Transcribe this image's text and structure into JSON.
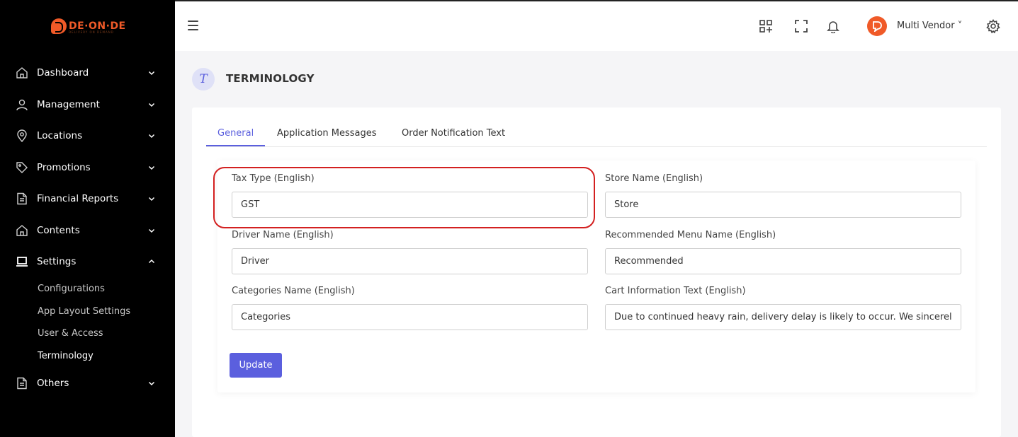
{
  "brand": {
    "logo_text": "DE·ON·DE",
    "logo_subtext": "DELIVERY ON DEMAND",
    "accent_color": "#f05a28"
  },
  "sidebar": {
    "items": [
      {
        "label": "Dashboard",
        "icon": "home-icon"
      },
      {
        "label": "Management",
        "icon": "user-icon"
      },
      {
        "label": "Locations",
        "icon": "map-pin-icon"
      },
      {
        "label": "Promotions",
        "icon": "tag-icon"
      },
      {
        "label": "Financial Reports",
        "icon": "file-icon"
      },
      {
        "label": "Contents",
        "icon": "home-icon"
      },
      {
        "label": "Settings",
        "icon": "laptop-icon"
      },
      {
        "label": "Others",
        "icon": "file-icon"
      }
    ],
    "settings_sub": [
      "Configurations",
      "App Layout Settings",
      "User & Access",
      "Terminology"
    ]
  },
  "header": {
    "user_name": "Multi Vendor ˅",
    "icons": [
      "apps-add-icon",
      "fullscreen-icon",
      "bell-icon",
      "gear-icon"
    ]
  },
  "page": {
    "badge_letter": "T",
    "title": "TERMINOLOGY"
  },
  "tabs": [
    "General",
    "Application Messages",
    "Order Notification Text"
  ],
  "form": {
    "tax_type_label": "Tax Type (English)",
    "tax_type_value": "GST",
    "store_name_label": "Store Name (English)",
    "store_name_value": "Store",
    "driver_name_label": "Driver Name (English)",
    "driver_name_value": "Driver",
    "recommended_label": "Recommended Menu Name (English)",
    "recommended_value": "Recommended",
    "categories_label": "Categories Name (English)",
    "categories_value": "Categories",
    "cart_info_label": "Cart Information Text (English)",
    "cart_info_value": "Due to continued heavy rain, delivery delay is likely to occur. We sincerely",
    "update_label": "Update"
  },
  "colors": {
    "primary": "#5b5fde",
    "highlight": "#d32020"
  }
}
